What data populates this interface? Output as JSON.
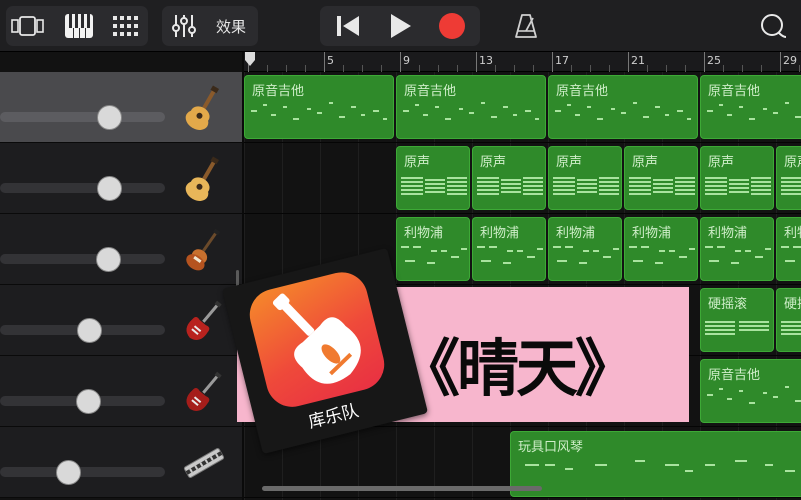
{
  "toolbar": {
    "fx_label": "效果"
  },
  "ruler": {
    "labels": [
      "5",
      "9",
      "13",
      "17",
      "21",
      "25",
      "29"
    ]
  },
  "tracks": [
    {
      "instrument_icon": "acoustic-guitar-icon",
      "selected": true,
      "volume": 0.67
    },
    {
      "instrument_icon": "acoustic-guitar-icon",
      "selected": false,
      "volume": 0.67
    },
    {
      "instrument_icon": "bass-guitar-icon",
      "selected": false,
      "volume": 0.66
    },
    {
      "instrument_icon": "electric-guitar-icon",
      "selected": false,
      "volume": 0.55
    },
    {
      "instrument_icon": "electric-guitar-icon",
      "selected": false,
      "volume": 0.54
    },
    {
      "instrument_icon": "harmonica-icon",
      "selected": false,
      "volume": 0.42
    }
  ],
  "regions": {
    "track1": [
      "原音吉他",
      "原音吉他",
      "原音吉他",
      "原音吉他"
    ],
    "track2": [
      "原声",
      "原声",
      "原声",
      "原声",
      "原声",
      "原声"
    ],
    "track3": [
      "利物浦",
      "利物浦",
      "利物浦",
      "利物浦",
      "利物浦",
      "利物浦"
    ],
    "track4": [
      "硬摇滚",
      "硬摇滚"
    ],
    "track5": [
      "原音吉他"
    ],
    "track6": [
      "玩具口风琴"
    ]
  },
  "overlay": {
    "title": "《晴天》",
    "app_name": "库乐队"
  },
  "colors": {
    "region_green": "#2f8a2a",
    "region_border": "#3da936",
    "record_red": "#ee3b35",
    "banner_pink": "#f7b6cd",
    "selected_track": "#4a4a4d"
  }
}
